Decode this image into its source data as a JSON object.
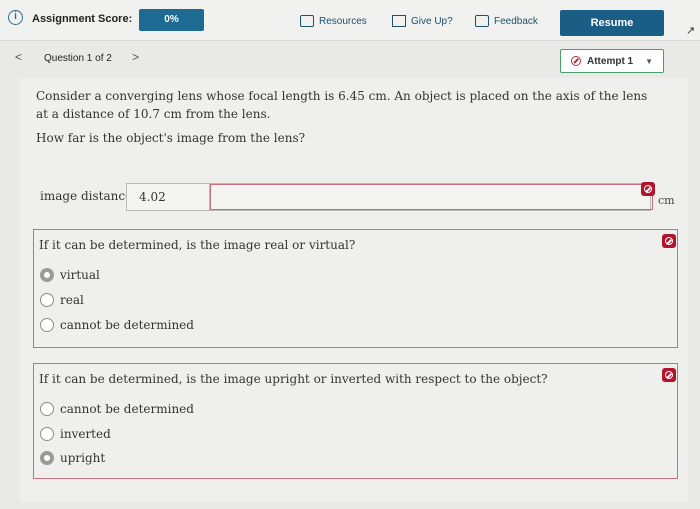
{
  "header": {
    "score_label": "Assignment Score:",
    "score_value": "0%",
    "resources": "Resources",
    "give_up": "Give Up?",
    "feedback": "Feedback",
    "resume": "Resume"
  },
  "question_nav": {
    "prev_icon": "<",
    "label": "Question 1 of 2",
    "next_icon": ">",
    "attempt": "Attempt 1"
  },
  "question": {
    "text": "Consider a converging lens whose focal length is 6.45 cm. An object is placed on the axis of the lens at a distance of 10.7 cm from the lens.",
    "ask": "How far is the object's image from the lens?"
  },
  "answer": {
    "label": "image distance:",
    "value": "4.02",
    "unit": "cm"
  },
  "part_real_virtual": {
    "title": "If it can be determined, is the image real or virtual?",
    "options": [
      "virtual",
      "real",
      "cannot be determined"
    ],
    "selected": "virtual"
  },
  "part_orientation": {
    "title": "If it can be determined, is the image upright or inverted with respect to the object?",
    "options": [
      "cannot be determined",
      "inverted",
      "upright"
    ],
    "selected": "upright"
  },
  "colors": {
    "accent": "#1d6a93",
    "error": "#b3142c",
    "correct_border": "#4a9c6a"
  }
}
